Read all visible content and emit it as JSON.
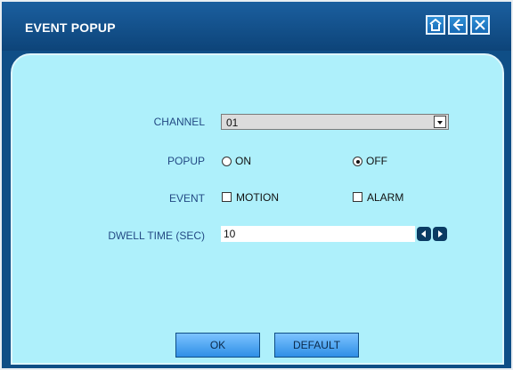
{
  "window": {
    "title": "EVENT POPUP"
  },
  "titlebar_buttons": [
    {
      "icon": "home-icon"
    },
    {
      "icon": "back-arrow-icon"
    },
    {
      "icon": "close-icon"
    }
  ],
  "form": {
    "channel": {
      "label": "CHANNEL",
      "value": "01"
    },
    "popup": {
      "label": "POPUP",
      "options": [
        "ON",
        "OFF"
      ],
      "selected": "OFF"
    },
    "event": {
      "label": "EVENT",
      "options": [
        "MOTION",
        "ALARM"
      ],
      "checked": []
    },
    "dwell": {
      "label": "DWELL TIME (SEC)",
      "value": "10"
    }
  },
  "buttons": {
    "ok": "OK",
    "default": "DEFAULT"
  },
  "colors": {
    "titlebar": "#1b5f9f",
    "panel": "#aef0fb",
    "labels": "#234a84"
  }
}
